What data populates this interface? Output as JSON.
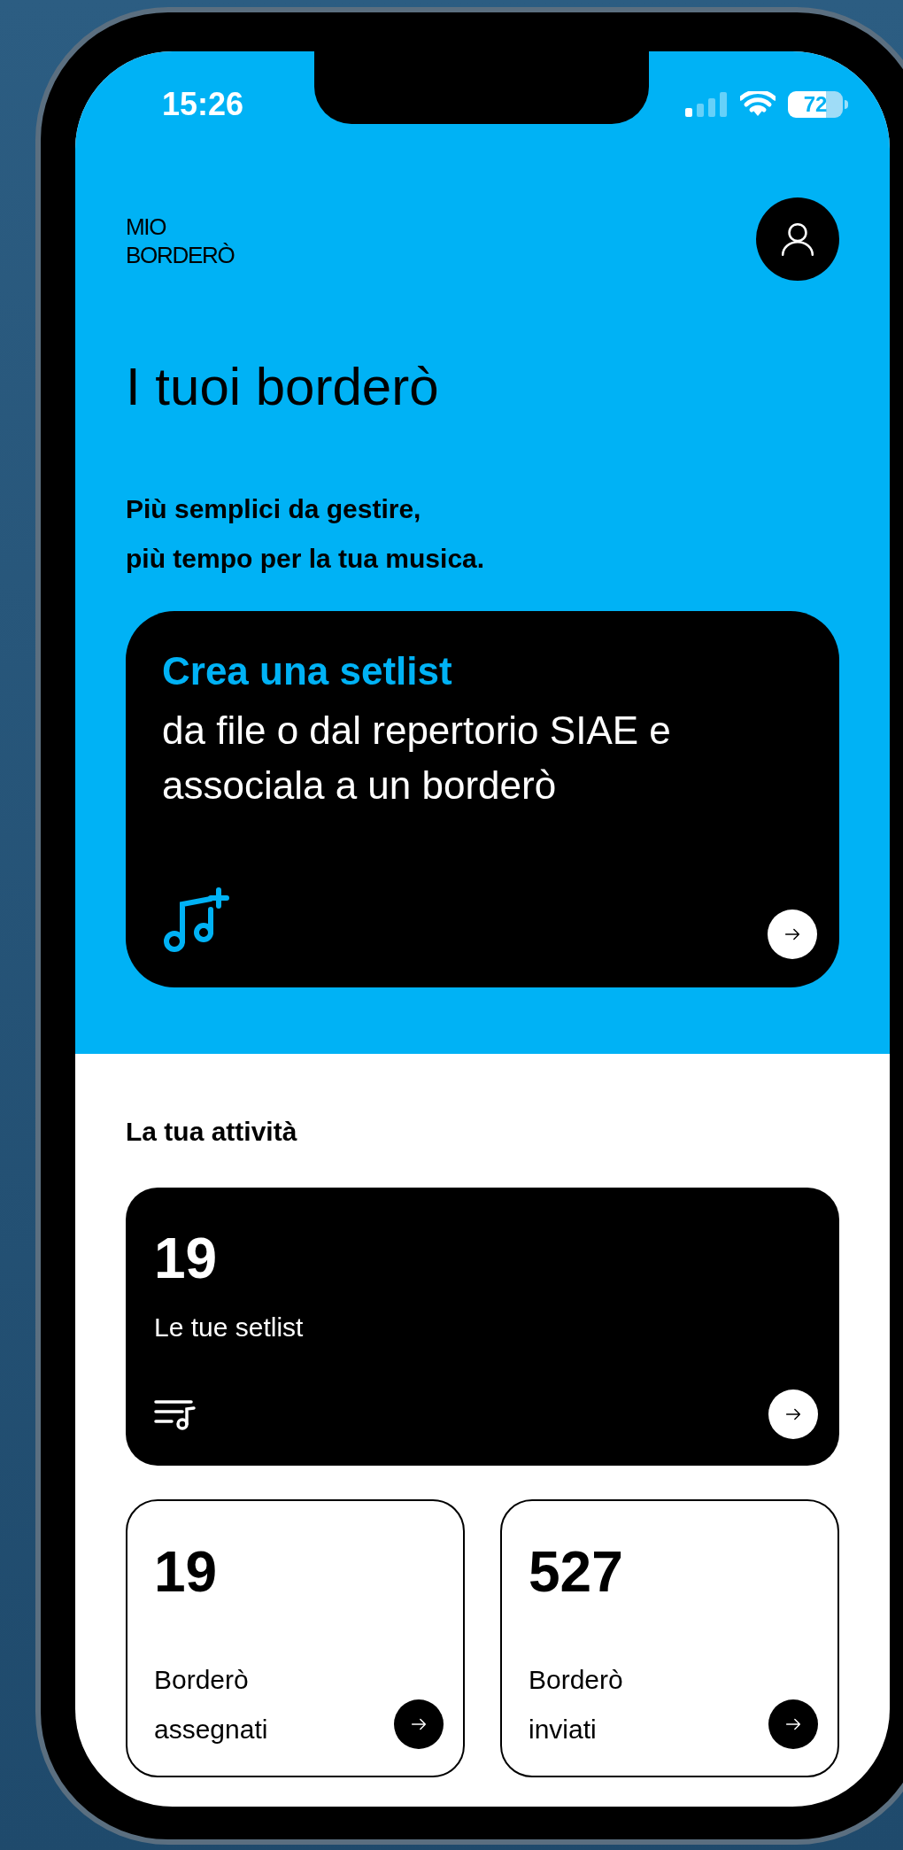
{
  "status_bar": {
    "time": "15:26",
    "battery": "72"
  },
  "header": {
    "logo_lines": [
      "MIO",
      "BORDERÒ"
    ]
  },
  "hero": {
    "title": "I tuoi borderò",
    "subtitle_lines": [
      "Più semplici da gestire,",
      "più tempo per la tua musica."
    ]
  },
  "promo_card": {
    "title": "Crea una setlist",
    "body": "da file o dal repertorio SIAE e associala a un borderò"
  },
  "activity": {
    "heading": "La tua attività",
    "cards": [
      {
        "kind": "dark",
        "count": "19",
        "label": "Le tue setlist"
      },
      {
        "kind": "outline",
        "count": "19",
        "label": "Borderò assegnati"
      },
      {
        "kind": "outline",
        "count": "527",
        "label": "Borderò inviati"
      }
    ]
  }
}
